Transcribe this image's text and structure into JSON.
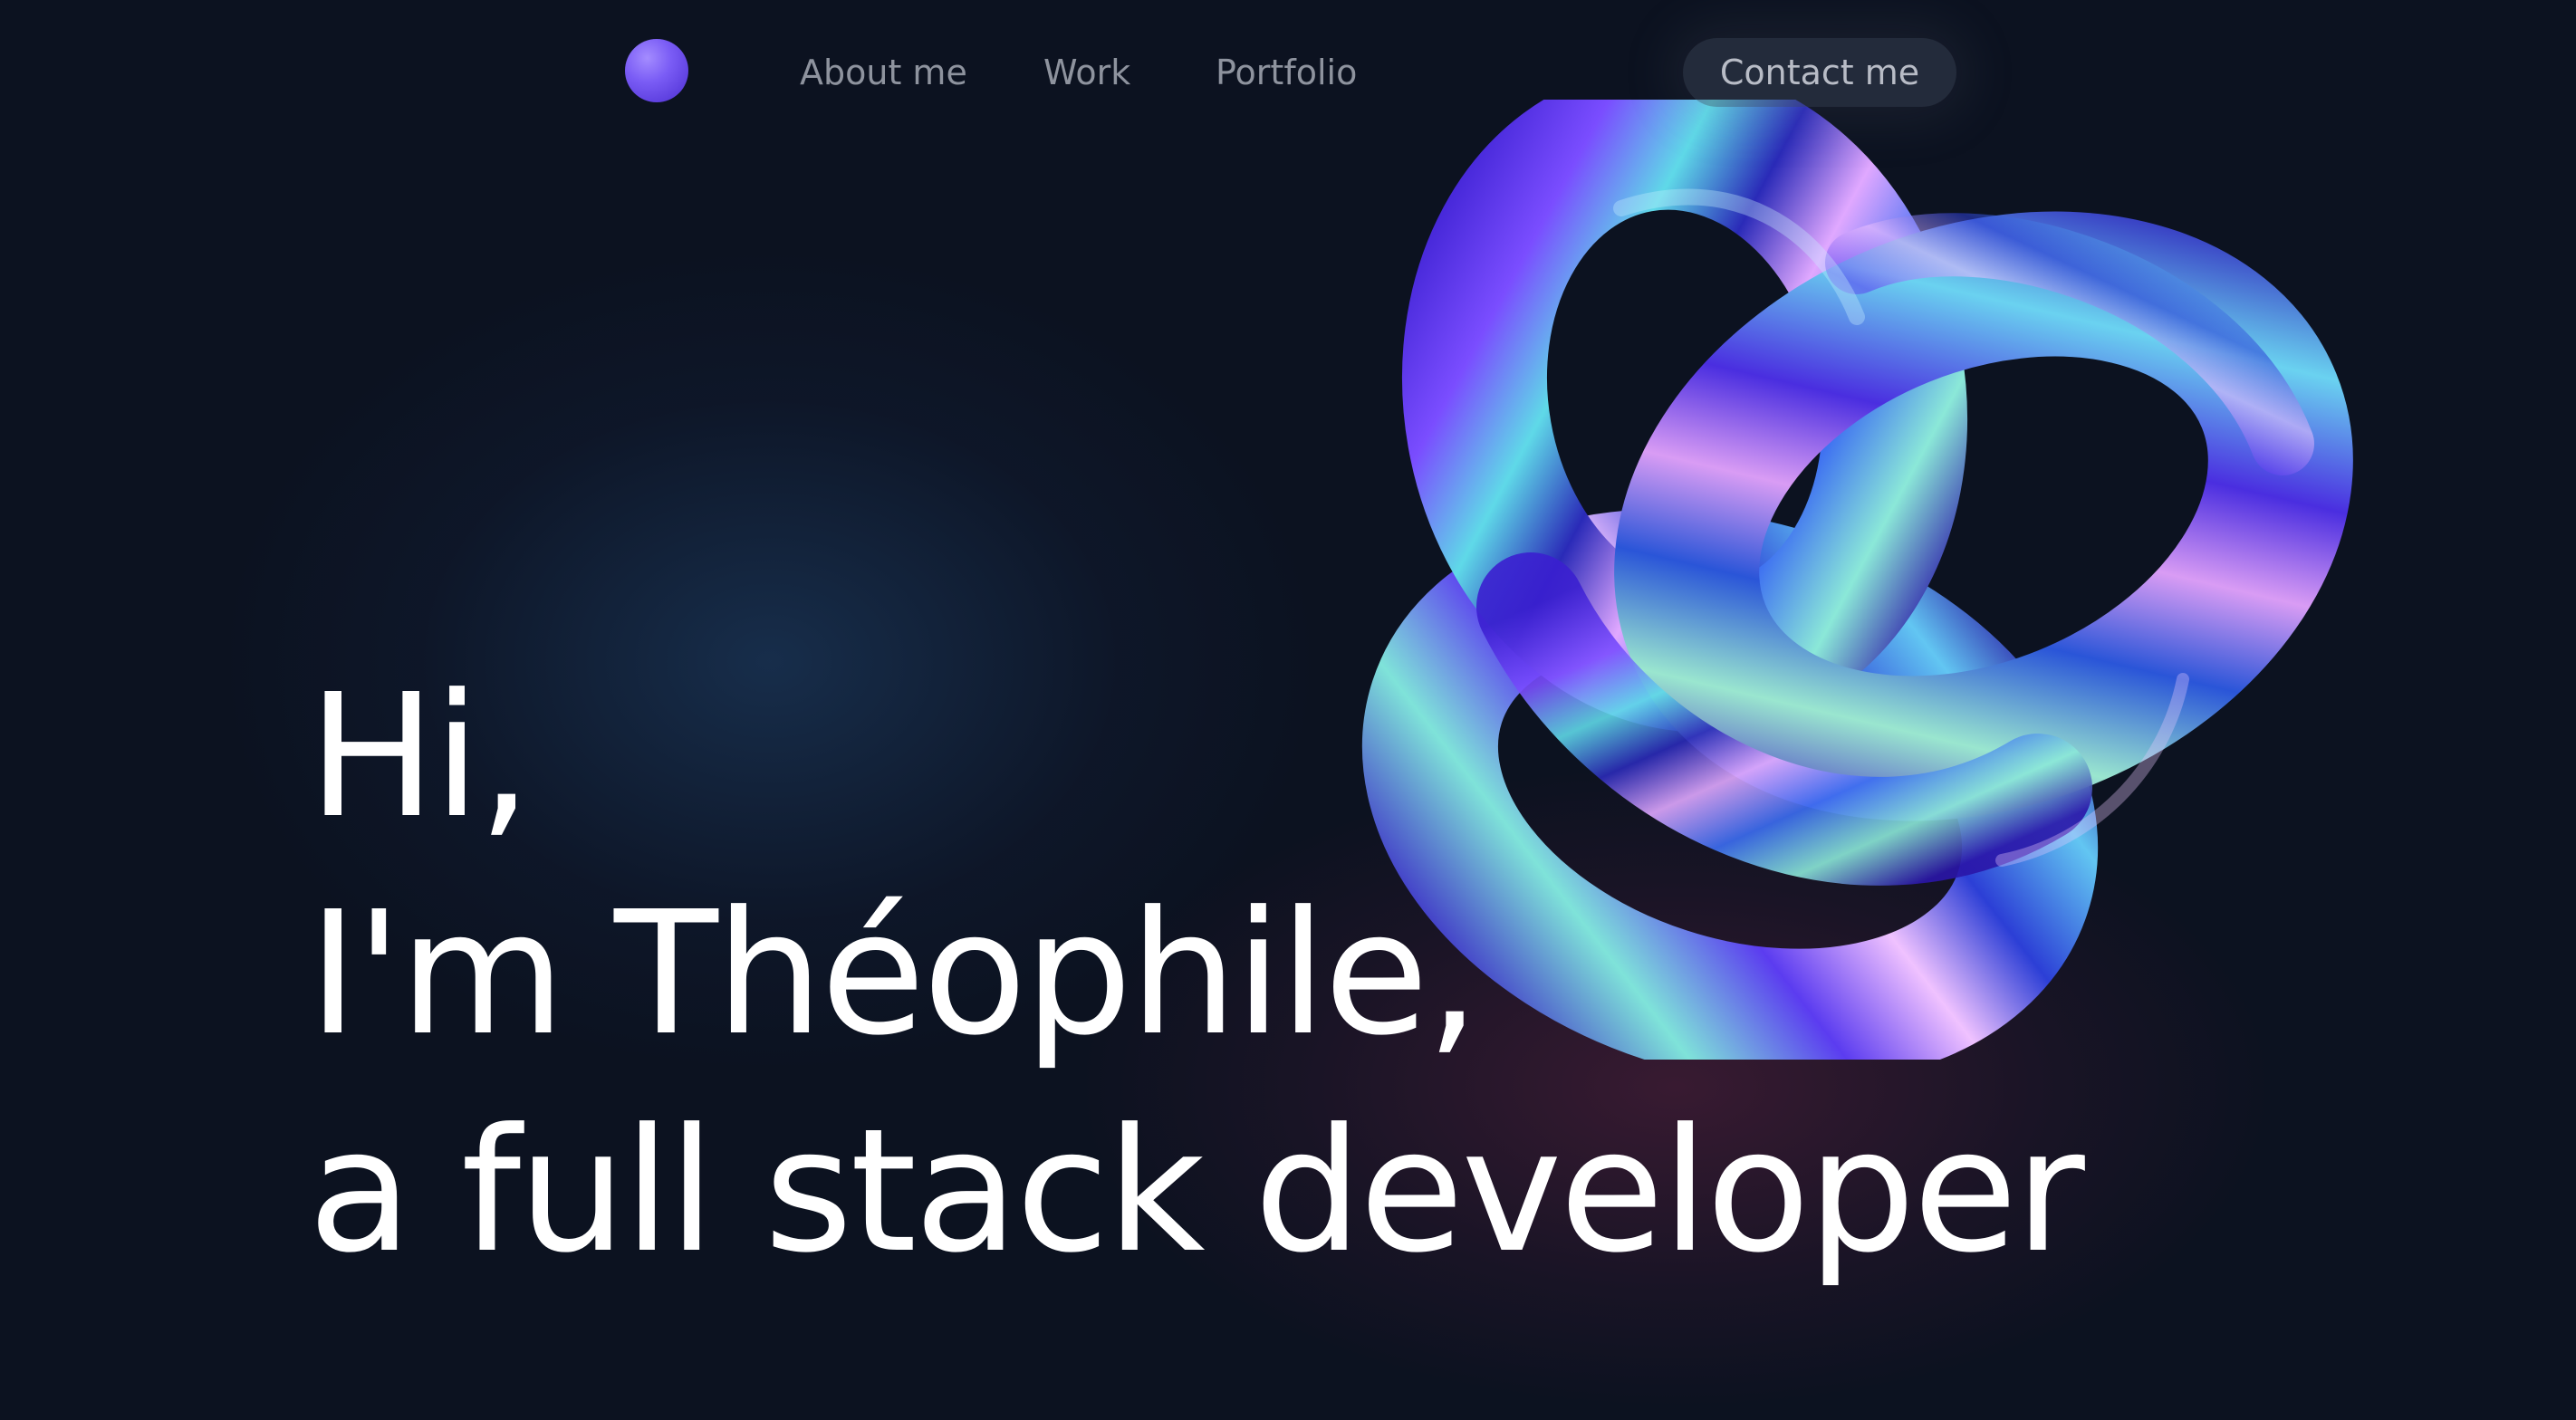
{
  "nav": {
    "links": [
      {
        "label": "About me"
      },
      {
        "label": "Work"
      },
      {
        "label": "Portfolio"
      }
    ],
    "contact_label": "Contact me"
  },
  "hero": {
    "line1": "Hi,",
    "line2": "I'm Théophile,",
    "line3": "a full stack developer"
  },
  "icons": {
    "logo": "gradient-orb-logo-icon",
    "art": "iridescent-trefoil-knot"
  },
  "colors": {
    "background": "#0c1220",
    "text": "#ffffff",
    "nav_text": "#8e939e",
    "accent": "#6f4df0"
  }
}
